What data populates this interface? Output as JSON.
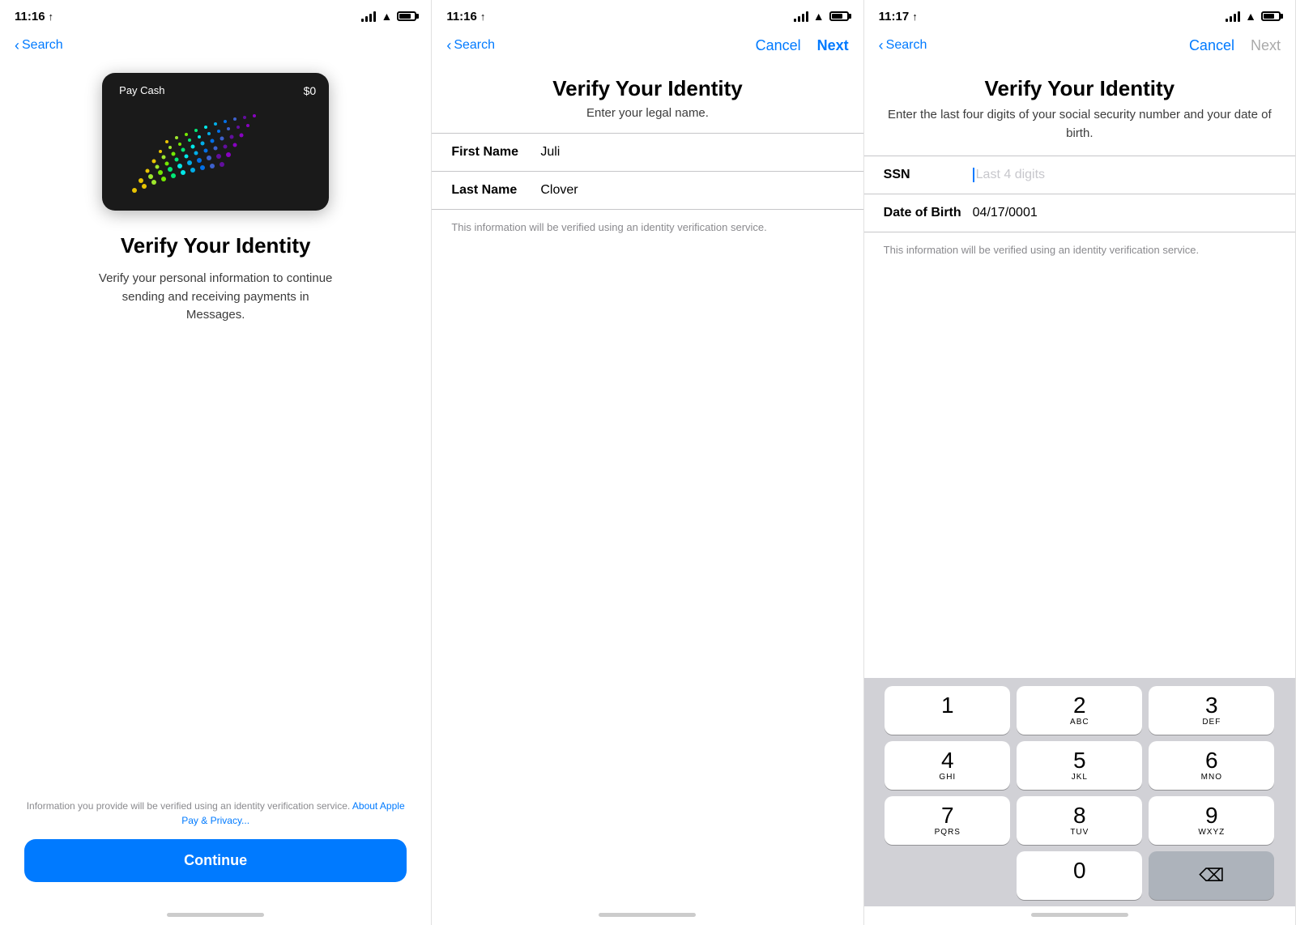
{
  "screen1": {
    "status_time": "11:16",
    "nav_back": "Search",
    "card_logo": " Pay Cash",
    "card_balance": "$0",
    "title": "Verify Your Identity",
    "subtitle": "Verify your personal information to continue sending and receiving payments in Messages.",
    "footer_text": "Information you provide will be verified using an identity verification service.",
    "footer_link": "About Apple Pay & Privacy...",
    "continue_label": "Continue"
  },
  "screen2": {
    "status_time": "11:16",
    "nav_back": "Search",
    "nav_cancel": "Cancel",
    "nav_next": "Next",
    "title": "Verify Your Identity",
    "subtitle": "Enter your legal name.",
    "first_name_label": "First Name",
    "first_name_value": "Juli",
    "last_name_label": "Last Name",
    "last_name_value": "Clover",
    "form_info": "This information will be verified using an identity verification service."
  },
  "screen3": {
    "status_time": "11:17",
    "nav_back": "Search",
    "nav_cancel": "Cancel",
    "nav_next": "Next",
    "title": "Verify Your Identity",
    "subtitle": "Enter the last four digits of your social security number and your date of birth.",
    "ssn_label": "SSN",
    "ssn_placeholder": "Last 4 digits",
    "dob_label": "Date of Birth",
    "dob_value": "04/17/0001",
    "form_info": "This information will be verified using an identity verification service.",
    "keypad": {
      "rows": [
        [
          {
            "num": "1",
            "letters": ""
          },
          {
            "num": "2",
            "letters": "ABC"
          },
          {
            "num": "3",
            "letters": "DEF"
          }
        ],
        [
          {
            "num": "4",
            "letters": "GHI"
          },
          {
            "num": "5",
            "letters": "JKL"
          },
          {
            "num": "6",
            "letters": "MNO"
          }
        ],
        [
          {
            "num": "7",
            "letters": "PQRS"
          },
          {
            "num": "8",
            "letters": "TUV"
          },
          {
            "num": "9",
            "letters": "WXYZ"
          }
        ],
        [
          {
            "num": "",
            "letters": ""
          },
          {
            "num": "0",
            "letters": ""
          },
          {
            "num": "del",
            "letters": ""
          }
        ]
      ]
    }
  }
}
